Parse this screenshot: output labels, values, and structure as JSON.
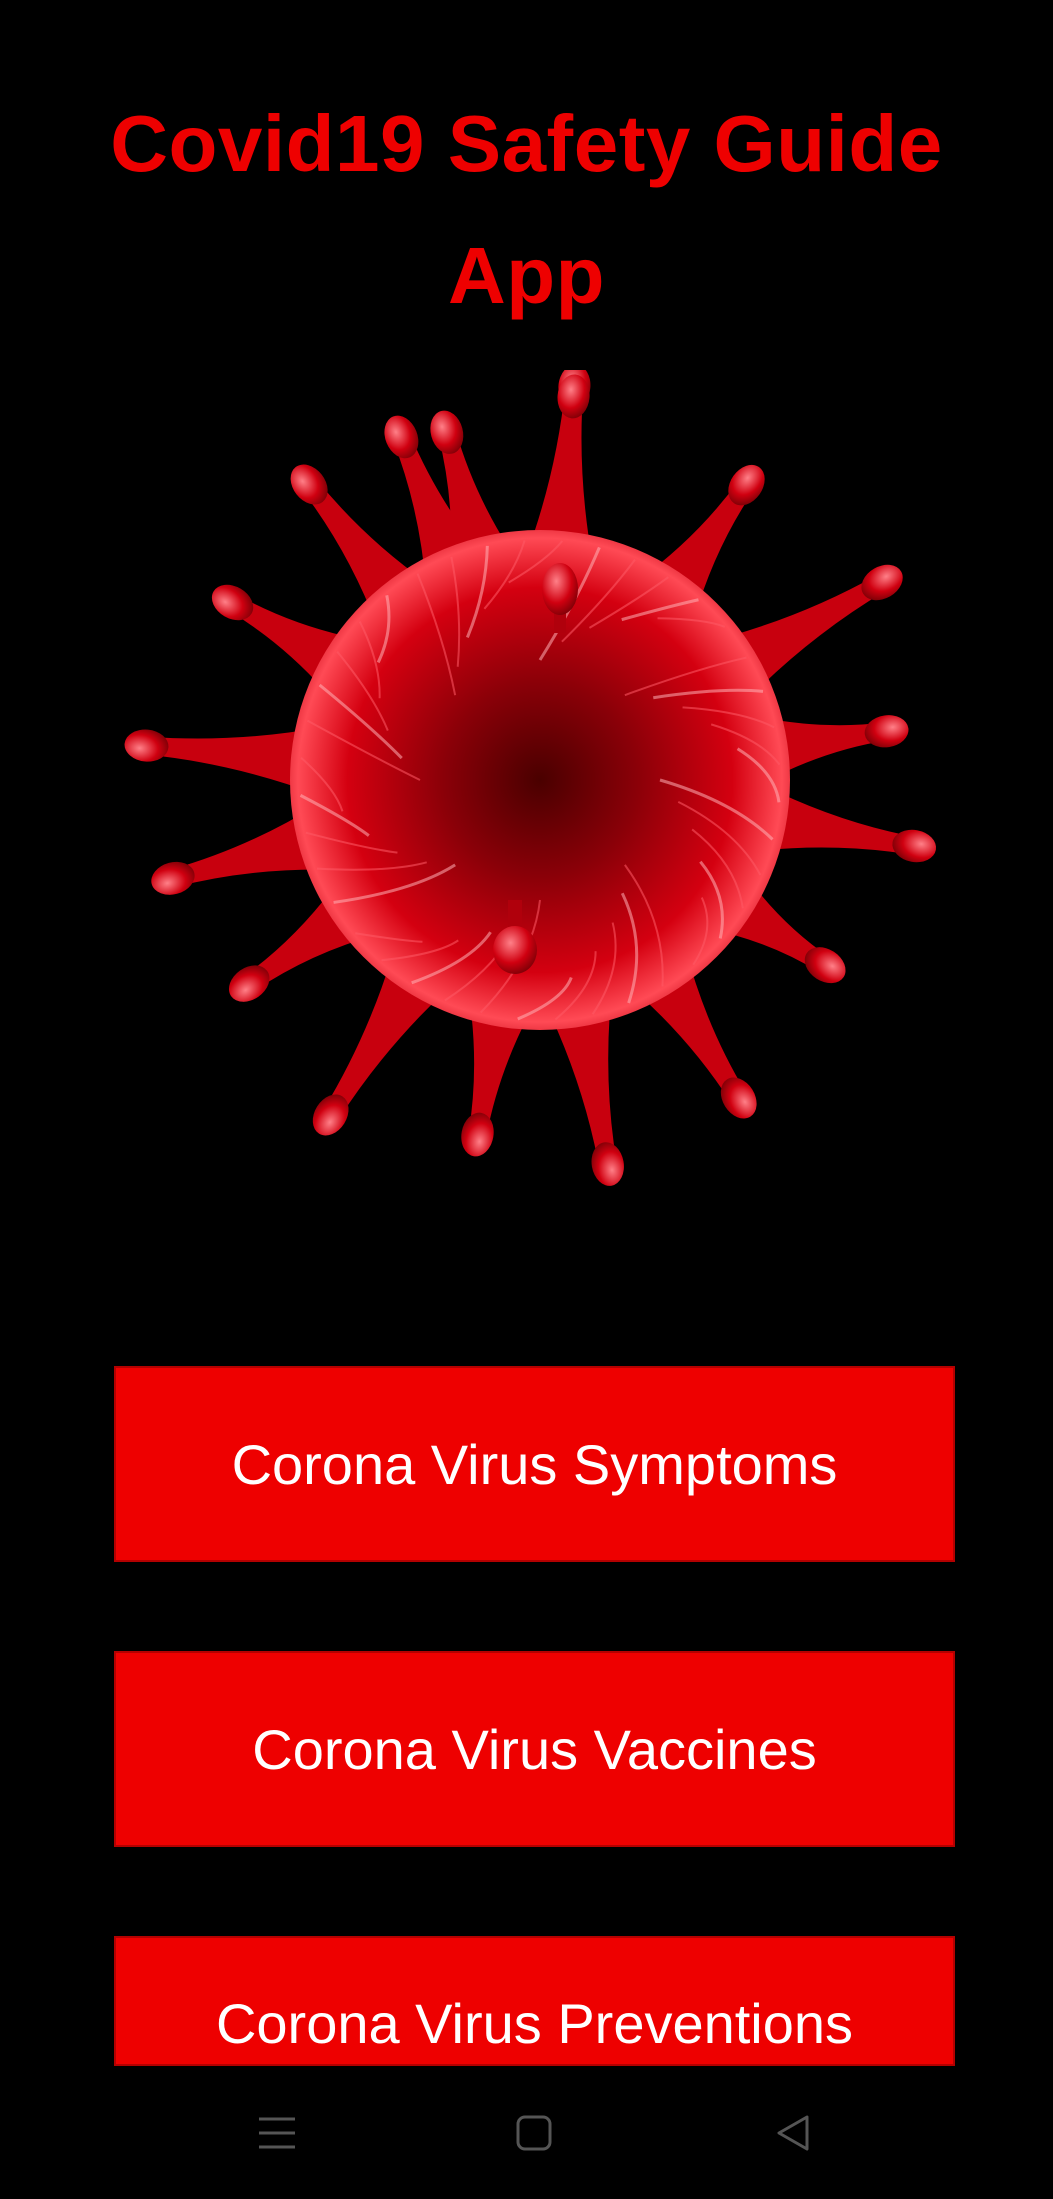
{
  "header": {
    "title_line1": "Covid19 Safety Guide",
    "title_line2": "App"
  },
  "hero_image": {
    "icon": "virus-icon",
    "color": "#e00000"
  },
  "menu": {
    "buttons": [
      {
        "label": "Corona Virus Symptoms"
      },
      {
        "label": "Corona Virus Vaccines"
      },
      {
        "label": "Corona Virus Preventions"
      }
    ]
  },
  "system_nav": {
    "items": [
      {
        "icon": "menu-icon"
      },
      {
        "icon": "home-icon"
      },
      {
        "icon": "back-icon"
      }
    ]
  },
  "colors": {
    "background": "#000000",
    "accent": "#ee0000",
    "button_text": "#ffffff"
  }
}
